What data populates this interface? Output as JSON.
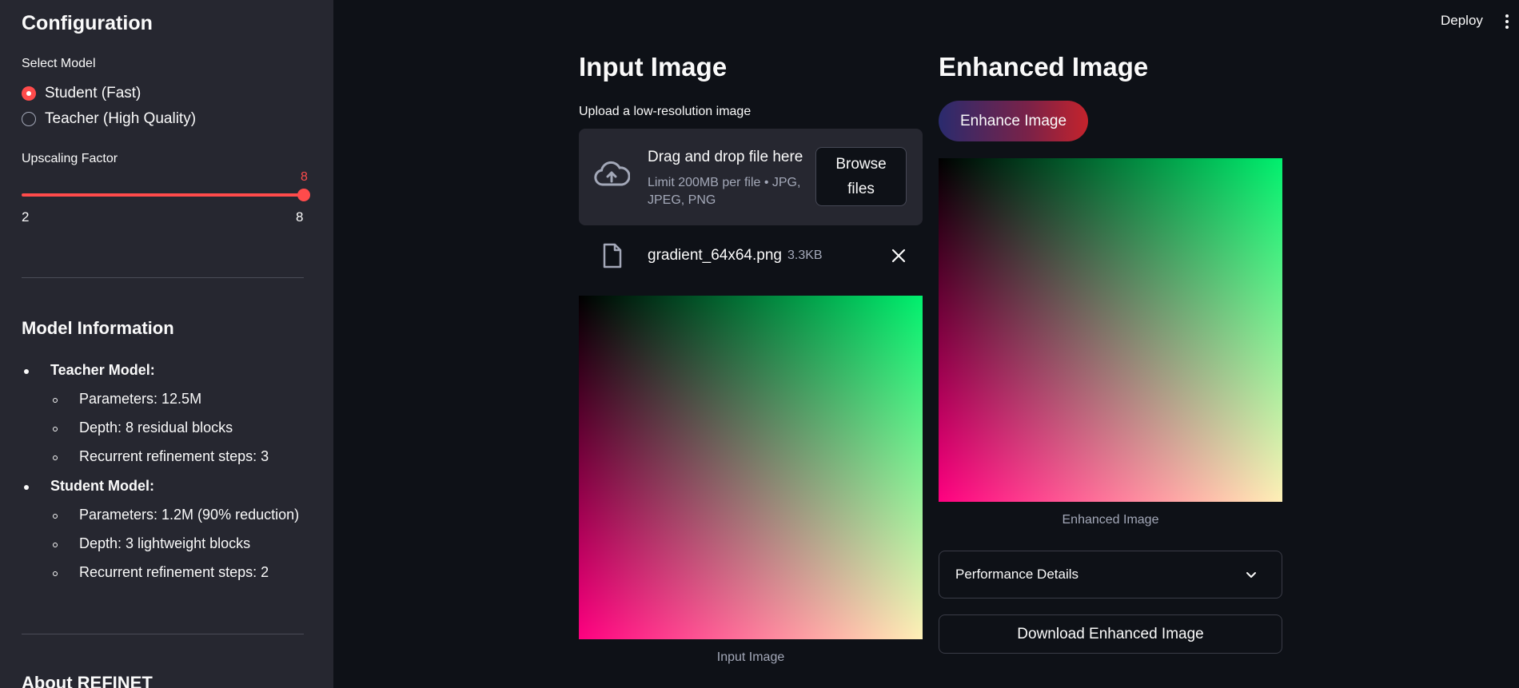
{
  "sidebar": {
    "title": "Configuration",
    "select_model_label": "Select Model",
    "models": [
      {
        "label": "Student (Fast)",
        "selected": true
      },
      {
        "label": "Teacher (High Quality)",
        "selected": false
      }
    ],
    "upscaling_label": "Upscaling Factor",
    "slider": {
      "value": "8",
      "min": "2",
      "max": "8"
    },
    "model_info_title": "Model Information",
    "teacher": {
      "heading": "Teacher Model:",
      "items": [
        "Parameters: 12.5M",
        "Depth: 8 residual blocks",
        "Recurrent refinement steps: 3"
      ]
    },
    "student": {
      "heading": "Student Model:",
      "items": [
        "Parameters: 1.2M (90% reduction)",
        "Depth: 3 lightweight blocks",
        "Recurrent refinement steps: 2"
      ]
    },
    "about_title": "About REFINET"
  },
  "header": {
    "deploy_label": "Deploy"
  },
  "input": {
    "title": "Input Image",
    "upload_label": "Upload a low-resolution image",
    "dropzone_main": "Drag and drop file here",
    "dropzone_sub": "Limit 200MB per file • JPG, JPEG, PNG",
    "browse_label": "Browse files",
    "file_name": "gradient_64x64.png",
    "file_size": "3.3KB",
    "caption": "Input Image"
  },
  "enhanced": {
    "title": "Enhanced Image",
    "enhance_button": "Enhance Image",
    "caption": "Enhanced Image",
    "performance_label": "Performance Details",
    "download_label": "Download Enhanced Image"
  },
  "colors": {
    "accent": "#ff4b4b",
    "background": "#0e1117",
    "sidebar": "#262730"
  }
}
